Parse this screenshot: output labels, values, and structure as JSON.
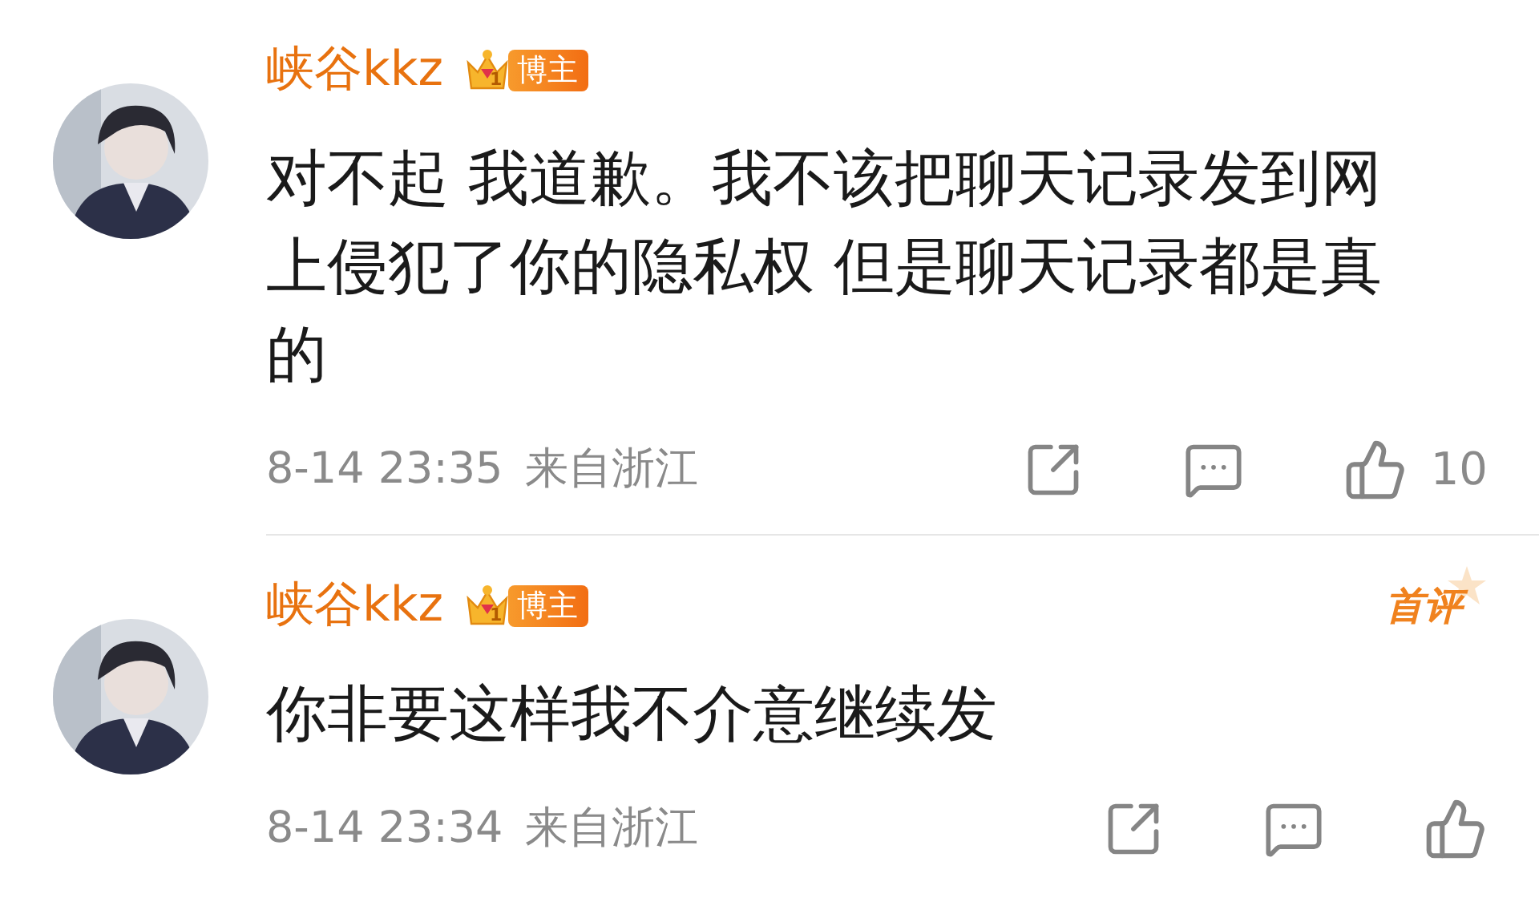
{
  "comments": [
    {
      "author": "峡谷kkz",
      "badge": {
        "level": "1",
        "label": "博主"
      },
      "text": "对不起 我道歉。我不该把聊天记录发到网上侵犯了你的隐私权 但是聊天记录都是真的",
      "time": "8-14 23:35",
      "location": "来自浙江",
      "like_count": "10"
    },
    {
      "author": "峡谷kkz",
      "badge": {
        "level": "1",
        "label": "博主"
      },
      "tag": "首评",
      "text": "你非要这样我不介意继续发",
      "time": "8-14 23:34",
      "location": "来自浙江"
    }
  ]
}
